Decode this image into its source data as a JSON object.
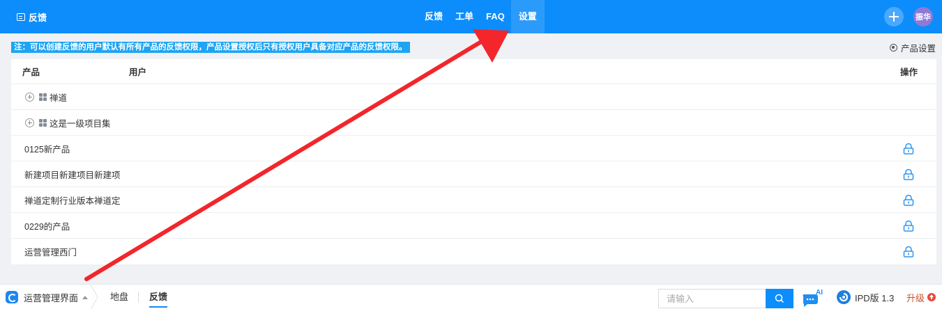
{
  "topbar": {
    "brand": "反馈",
    "nav": [
      "反馈",
      "工单",
      "FAQ",
      "设置"
    ],
    "active_nav": "设置",
    "avatar_text": "振华"
  },
  "notice": "注：可以创建反馈的用户默认有所有产品的反馈权限，产品设置授权后只有授权用户具备对应产品的反馈权限。",
  "product_settings_label": "产品设置",
  "table": {
    "headers": {
      "product": "产品",
      "user": "用户",
      "action": "操作"
    },
    "groups": [
      "禅道",
      "这是一级项目集"
    ],
    "rows": [
      "0125新产品",
      "新建项目新建项目新建项",
      "禅道定制行业版本禅道定",
      "0229的产品",
      "运营管理西门"
    ]
  },
  "bottombar": {
    "app_name": "运营管理界面",
    "tabs": [
      "地盘",
      "反馈"
    ],
    "active_tab": "反馈",
    "search_placeholder": "请输入",
    "ai_label": "AI",
    "version": "IPD版 1.3",
    "upgrade": "升级"
  },
  "colors": {
    "primary": "#0c8dfb",
    "notice_bg": "#1fa4f2",
    "arrow": "#f2262b",
    "lock": "#2b95f0"
  }
}
